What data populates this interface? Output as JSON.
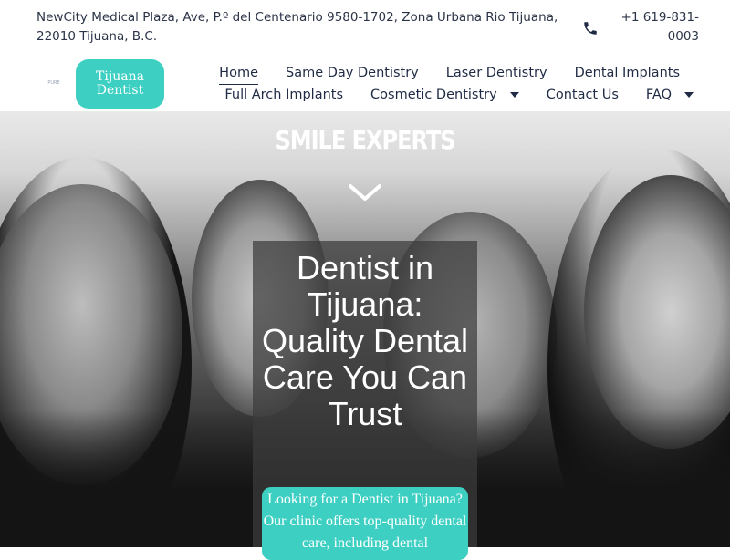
{
  "topbar": {
    "address": "NewCity Medical Plaza, Ave, P.º del Centenario 9580-1702, Zona Urbana Rio Tijuana, 22010 Tijuana, B.C.",
    "phone": "+1 619-831-0003",
    "phone_icon": "phone-icon"
  },
  "header": {
    "small_logo_text": "PURE",
    "logo_line1": "Tijuana",
    "logo_line2": "Dentist",
    "logo_color": "#3dcfc2"
  },
  "nav": {
    "row1": [
      {
        "label": "Home",
        "active": true
      },
      {
        "label": "Same Day Dentistry"
      },
      {
        "label": "Laser Dentistry"
      },
      {
        "label": "Dental Implants"
      }
    ],
    "row2": [
      {
        "label": "Full Arch Implants"
      },
      {
        "label": "Cosmetic Dentistry",
        "dropdown": true
      },
      {
        "label": "Contact Us"
      },
      {
        "label": "FAQ",
        "dropdown": true
      }
    ]
  },
  "hero": {
    "tagline": "SMILE EXPERTS",
    "headline": "Dentist in Tijuana: Quality Dental Care You Can Trust",
    "intro": "Looking for a Dentist in Tijuana? Our clinic offers top-quality dental care, including dental",
    "accent_color": "#3dcfc2"
  }
}
